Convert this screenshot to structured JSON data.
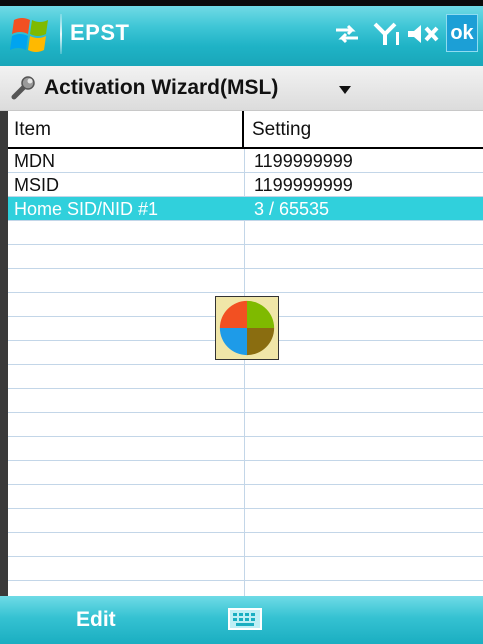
{
  "titlebar": {
    "app_title": "EPST",
    "ok_label": "ok",
    "icons": [
      "windows-start-icon",
      "connectivity-icon",
      "signal-icon",
      "volume-muted-icon"
    ]
  },
  "menubar": {
    "title": "Activation Wizard(MSL)",
    "icon": "wrench-icon",
    "dropdown_icon": "chevron-down-icon"
  },
  "table": {
    "headers": {
      "item": "Item",
      "setting": "Setting"
    },
    "rows": [
      {
        "item": "MDN",
        "setting": "1199999999"
      },
      {
        "item": "MSID",
        "setting": "1199999999"
      },
      {
        "item": "Home SID/NID #1",
        "setting": "3 / 65535",
        "selected": true
      }
    ],
    "selection_color": "#30d0dc"
  },
  "busy_indicator": {
    "icon": "wait-icon"
  },
  "softbar": {
    "left_label": "Edit",
    "center_icon": "keyboard-icon"
  },
  "colors": {
    "bar_accent": "#1fb3c6",
    "selection": "#30d0dc"
  }
}
